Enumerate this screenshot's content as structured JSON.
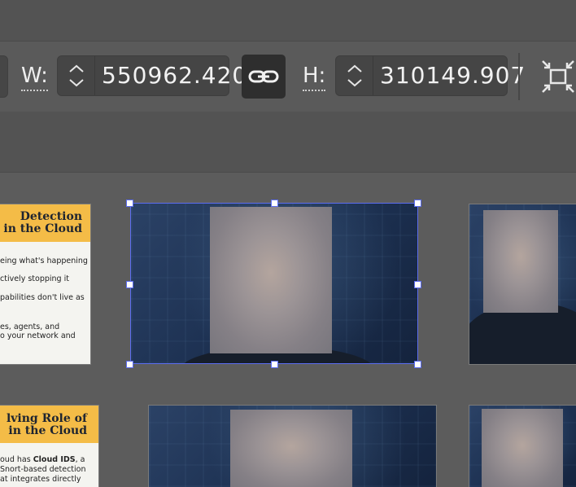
{
  "toolbar": {
    "width_label": "W:",
    "width_value": "550962.420",
    "height_label": "H:",
    "height_value": "310149.907",
    "icons": {
      "stepper": "chevron-up-down-icon",
      "link": "link-chain-icon",
      "fit": "fit-to-frame-icon"
    }
  },
  "slides": {
    "detection": {
      "title_line1": "Detection",
      "title_line2": "on in the Cloud",
      "lines": [
        "eing what's happening",
        "ctively stopping it",
        "pabilities don't live as",
        "es, agents, and",
        "o your network and"
      ]
    },
    "role": {
      "title_line1": "lving Role of",
      "title_line2": "in the Cloud",
      "line1_prefix": "oud has ",
      "line1_bold": "Cloud IDS",
      "line1_suffix": ", a",
      "line2": "Snort-based detection",
      "line3": "at integrates directly"
    }
  },
  "colors": {
    "selection": "#5c6df0",
    "slide_band": "#f4bc47",
    "canvas": "#5c5c5c",
    "toolbar": "#5a5a5a"
  }
}
